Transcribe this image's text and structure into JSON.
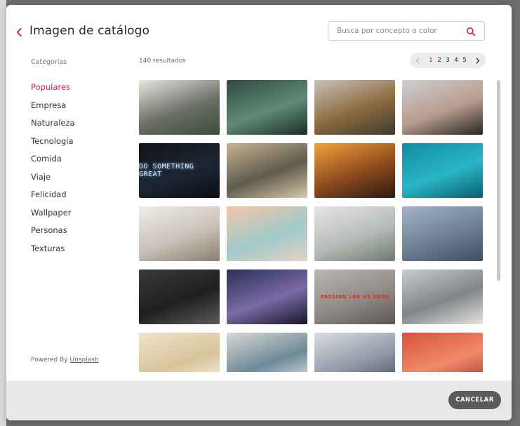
{
  "modal": {
    "title": "Imagen de catálogo",
    "back_icon": "chevron-left-icon",
    "accent_color": "#d81b60"
  },
  "search": {
    "placeholder": "Busca por concepto o color",
    "value": "",
    "icon": "search-icon"
  },
  "sidebar": {
    "heading": "Categorías",
    "items": [
      {
        "label": "Populares",
        "active": true
      },
      {
        "label": "Empresa",
        "active": false
      },
      {
        "label": "Naturaleza",
        "active": false
      },
      {
        "label": "Tecnología",
        "active": false
      },
      {
        "label": "Comida",
        "active": false
      },
      {
        "label": "Viaje",
        "active": false
      },
      {
        "label": "Felicidad",
        "active": false
      },
      {
        "label": "Wallpaper",
        "active": false
      },
      {
        "label": "Personas",
        "active": false
      },
      {
        "label": "Texturas",
        "active": false
      }
    ],
    "powered_prefix": "Powered By",
    "powered_link": "Unsplash"
  },
  "results": {
    "count_label": "140 resultados"
  },
  "pagination": {
    "prev_icon": "chevron-left-icon",
    "next_icon": "chevron-right-icon",
    "pages": [
      "1",
      "2",
      "3",
      "4",
      "5"
    ],
    "current": "1"
  },
  "images": [
    {
      "name": "laptop-desk-image",
      "colors": [
        "#e8e6e0",
        "#6b6f66",
        "#3c4a3d"
      ],
      "text": ""
    },
    {
      "name": "succulents-image",
      "colors": [
        "#2f4a3f",
        "#5f8a76",
        "#1c2d27"
      ],
      "text": ""
    },
    {
      "name": "dinner-table-image",
      "colors": [
        "#c9c2b7",
        "#8c6a3e",
        "#3a3a33"
      ],
      "text": ""
    },
    {
      "name": "portrait-man-image",
      "colors": [
        "#cfcfd3",
        "#b89c8c",
        "#262626"
      ],
      "text": ""
    },
    {
      "name": "neon-sign-image",
      "colors": [
        "#10141a",
        "#1c2633",
        "#0b0e12"
      ],
      "text": "DO SOMETHING GREAT"
    },
    {
      "name": "typewriter-image",
      "colors": [
        "#c7b391",
        "#5f5b4e",
        "#d9c9a6"
      ],
      "text": ""
    },
    {
      "name": "heart-sunset-image",
      "colors": [
        "#f2a23b",
        "#8c4a1d",
        "#2a1b14"
      ],
      "text": ""
    },
    {
      "name": "teal-bokeh-image",
      "colors": [
        "#0f8ea0",
        "#2ab5c4",
        "#0a5f70"
      ],
      "text": ""
    },
    {
      "name": "writing-notebook-image",
      "colors": [
        "#f0ede8",
        "#c9c2b8",
        "#8a7e70"
      ],
      "text": ""
    },
    {
      "name": "beach-sunset-image",
      "colors": [
        "#f4c8a8",
        "#9fc9c9",
        "#e3d2c2"
      ],
      "text": ""
    },
    {
      "name": "workspace-monitor-image",
      "colors": [
        "#e6e6e4",
        "#b7bcb8",
        "#6e7b70"
      ],
      "text": ""
    },
    {
      "name": "misty-mountains-image",
      "colors": [
        "#a3b4c6",
        "#6b7f95",
        "#3d4d60"
      ],
      "text": ""
    },
    {
      "name": "black-desk-image",
      "colors": [
        "#3a3a3a",
        "#1f1f1f",
        "#5a5a5a"
      ],
      "text": ""
    },
    {
      "name": "milky-way-image",
      "colors": [
        "#2a2f55",
        "#7a6aa8",
        "#151826"
      ],
      "text": ""
    },
    {
      "name": "passion-led-us-here-image",
      "colors": [
        "#b9b6b3",
        "#8f8b88",
        "#5a5652"
      ],
      "text": "PASSION LED US HERE"
    },
    {
      "name": "laptop-meeting-image",
      "colors": [
        "#c7ccd1",
        "#7f858a",
        "#e6e1da"
      ],
      "text": ""
    },
    {
      "name": "dandelion-image",
      "colors": [
        "#efe3c9",
        "#d8c49b",
        "#f7f1e3"
      ],
      "text": ""
    },
    {
      "name": "team-desk-image",
      "colors": [
        "#d9d7d2",
        "#6d8a9a",
        "#f0efe9"
      ],
      "text": ""
    },
    {
      "name": "snowy-peaks-image",
      "colors": [
        "#d9dde2",
        "#8f9aa6",
        "#444d57"
      ],
      "text": ""
    },
    {
      "name": "red-smoke-image",
      "colors": [
        "#d9523a",
        "#f08a6a",
        "#a8301f"
      ],
      "text": ""
    }
  ],
  "footer": {
    "cancel_label": "CANCELAR"
  }
}
